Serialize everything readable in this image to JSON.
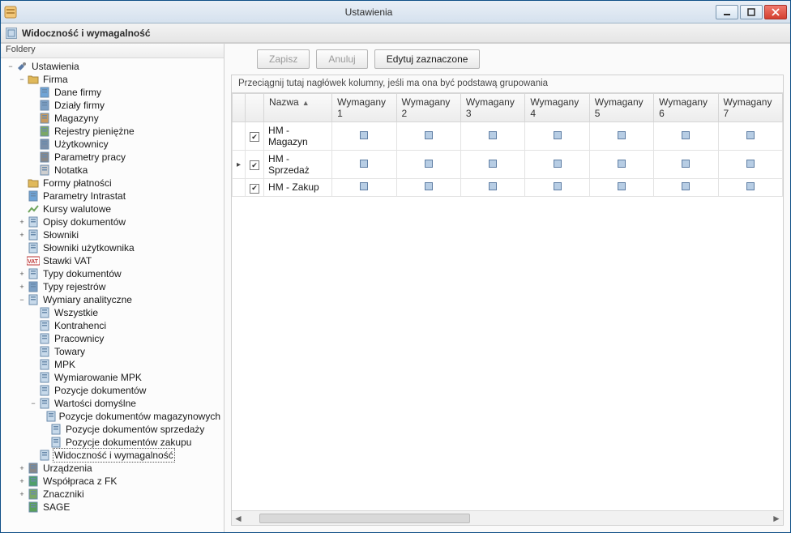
{
  "window": {
    "title": "Ustawienia"
  },
  "subheader": {
    "title": "Widoczność i wymagalność"
  },
  "sidebar": {
    "header": "Foldery",
    "nodes": [
      {
        "label": "Ustawienia",
        "expander": "−",
        "indent": 1,
        "icon": "tools"
      },
      {
        "label": "Firma",
        "expander": "−",
        "indent": 2,
        "icon": "folder"
      },
      {
        "label": "Dane firmy",
        "expander": "",
        "indent": 3,
        "icon": "card"
      },
      {
        "label": "Działy firmy",
        "expander": "",
        "indent": 3,
        "icon": "grid"
      },
      {
        "label": "Magazyny",
        "expander": "",
        "indent": 3,
        "icon": "box"
      },
      {
        "label": "Rejestry pieniężne",
        "expander": "",
        "indent": 3,
        "icon": "money"
      },
      {
        "label": "Użytkownicy",
        "expander": "",
        "indent": 3,
        "icon": "users"
      },
      {
        "label": "Parametry pracy",
        "expander": "",
        "indent": 3,
        "icon": "gear"
      },
      {
        "label": "Notatka",
        "expander": "",
        "indent": 3,
        "icon": "note"
      },
      {
        "label": "Formy płatności",
        "expander": "",
        "indent": 2,
        "icon": "folder"
      },
      {
        "label": "Parametry Intrastat",
        "expander": "",
        "indent": 2,
        "icon": "flag"
      },
      {
        "label": "Kursy walutowe",
        "expander": "",
        "indent": 2,
        "icon": "chart"
      },
      {
        "label": "Opisy dokumentów",
        "expander": "+",
        "indent": 2,
        "icon": "doc"
      },
      {
        "label": "Słowniki",
        "expander": "+",
        "indent": 2,
        "icon": "doc"
      },
      {
        "label": "Słowniki użytkownika",
        "expander": "",
        "indent": 2,
        "icon": "doc"
      },
      {
        "label": "Stawki VAT",
        "expander": "",
        "indent": 2,
        "icon": "vat"
      },
      {
        "label": "Typy dokumentów",
        "expander": "+",
        "indent": 2,
        "icon": "doc"
      },
      {
        "label": "Typy rejestrów",
        "expander": "+",
        "indent": 2,
        "icon": "grid"
      },
      {
        "label": "Wymiary analityczne",
        "expander": "−",
        "indent": 2,
        "icon": "doc"
      },
      {
        "label": "Wszystkie",
        "expander": "",
        "indent": 3,
        "icon": "doc"
      },
      {
        "label": "Kontrahenci",
        "expander": "",
        "indent": 3,
        "icon": "doc"
      },
      {
        "label": "Pracownicy",
        "expander": "",
        "indent": 3,
        "icon": "doc"
      },
      {
        "label": "Towary",
        "expander": "",
        "indent": 3,
        "icon": "doc"
      },
      {
        "label": "MPK",
        "expander": "",
        "indent": 3,
        "icon": "doc"
      },
      {
        "label": "Wymiarowanie MPK",
        "expander": "",
        "indent": 3,
        "icon": "doc"
      },
      {
        "label": "Pozycje dokumentów",
        "expander": "",
        "indent": 3,
        "icon": "doc"
      },
      {
        "label": "Wartości domyślne",
        "expander": "−",
        "indent": 3,
        "icon": "doc"
      },
      {
        "label": "Pozycje dokumentów magazynowych",
        "expander": "",
        "indent": 4,
        "icon": "doc"
      },
      {
        "label": "Pozycje dokumentów sprzedaży",
        "expander": "",
        "indent": 4,
        "icon": "doc"
      },
      {
        "label": "Pozycje dokumentów zakupu",
        "expander": "",
        "indent": 4,
        "icon": "doc"
      },
      {
        "label": "Widoczność i wymagalność",
        "expander": "",
        "indent": 3,
        "icon": "doc",
        "selected": true
      },
      {
        "label": "Urządzenia",
        "expander": "+",
        "indent": 2,
        "icon": "printer"
      },
      {
        "label": "Współpraca z FK",
        "expander": "+",
        "indent": 2,
        "icon": "fk"
      },
      {
        "label": "Znaczniki",
        "expander": "+",
        "indent": 2,
        "icon": "tag"
      },
      {
        "label": "SAGE",
        "expander": "",
        "indent": 2,
        "icon": "sage"
      }
    ]
  },
  "toolbar": {
    "save": "Zapisz",
    "cancel": "Anuluj",
    "edit_selected": "Edytuj zaznaczone"
  },
  "grid": {
    "group_hint": "Przeciągnij tutaj nagłówek kolumny, jeśli ma ona być podstawą grupowania",
    "columns": [
      "",
      "",
      "Nazwa",
      "Wymagany 1",
      "Wymagany 2",
      "Wymagany 3",
      "Wymagany 4",
      "Wymagany 5",
      "Wymagany 6",
      "Wymagany 7"
    ],
    "sort_column": "Nazwa",
    "rows": [
      {
        "current": false,
        "checked": true,
        "name": "HM - Magazyn"
      },
      {
        "current": true,
        "checked": true,
        "name": "HM - Sprzedaż"
      },
      {
        "current": false,
        "checked": true,
        "name": "HM - Zakup"
      }
    ]
  }
}
